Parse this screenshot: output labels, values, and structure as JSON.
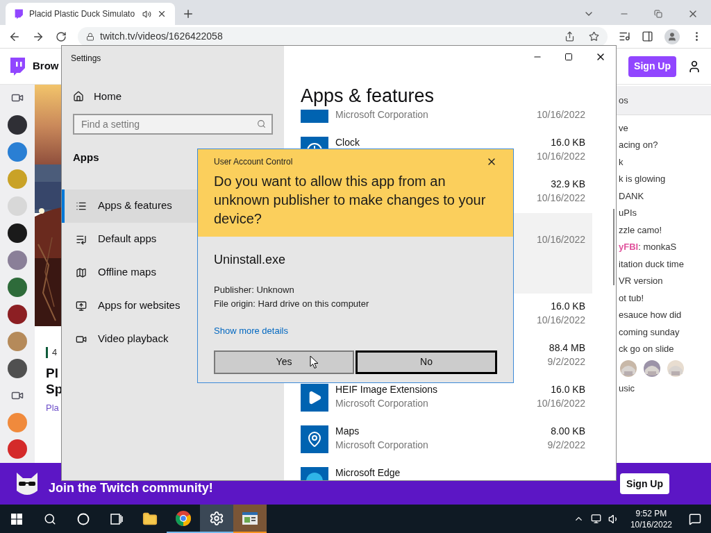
{
  "browser": {
    "tabs": [
      {
        "title": "Placid Plastic Duck Simulato",
        "selected": true,
        "audio": true
      }
    ],
    "url": "twitch.tv/videos/1626422058"
  },
  "twitch": {
    "nav_link": "Brow",
    "sign_up": "Sign Up",
    "rail": [
      {
        "kind": "camera"
      },
      {
        "kind": "avatar",
        "color": "#2f2f35"
      },
      {
        "kind": "avatar",
        "color": "#2a7fd4"
      },
      {
        "kind": "avatar",
        "color": "#c9a227"
      },
      {
        "kind": "avatar",
        "color": "#d8d8d8"
      },
      {
        "kind": "avatar",
        "color": "#1a1a1a"
      },
      {
        "kind": "avatar",
        "color": "#8a7f98"
      },
      {
        "kind": "avatar",
        "color": "#2e6b3a"
      },
      {
        "kind": "avatar",
        "color": "#8c1f23"
      },
      {
        "kind": "avatar",
        "color": "#b58a5a"
      },
      {
        "kind": "avatar",
        "color": "#505050"
      },
      {
        "kind": "camera"
      },
      {
        "kind": "avatar",
        "color": "#f08a3c"
      },
      {
        "kind": "avatar",
        "color": "#d42a2a"
      }
    ],
    "video": {
      "tag": "4",
      "title_lines": [
        "Pl",
        "Sp"
      ],
      "channel": "Pla"
    },
    "chat": {
      "header": "os",
      "messages": [
        {
          "kind": "text",
          "text": "ve"
        },
        {
          "kind": "text",
          "text": "acing on?"
        },
        {
          "kind": "text",
          "text": "k"
        },
        {
          "kind": "text",
          "text": "k is glowing"
        },
        {
          "kind": "text",
          "text": "DANK"
        },
        {
          "kind": "text",
          "text": "uPIs"
        },
        {
          "kind": "text",
          "text": "zzle camo!"
        },
        {
          "kind": "text",
          "user": "yFBI",
          "color": "#e0529c",
          "text": ": monkaS"
        },
        {
          "kind": "text",
          "text": "itation duck time"
        },
        {
          "kind": "text",
          "text": "VR version"
        },
        {
          "kind": "text",
          "text": "ot tub!"
        },
        {
          "kind": "text",
          "text": "esauce how did"
        },
        {
          "kind": "text",
          "text": "coming sunday"
        },
        {
          "kind": "text",
          "text": "ck go on slide"
        },
        {
          "kind": "emotes"
        },
        {
          "kind": "text",
          "text": "usic"
        }
      ]
    },
    "banner": {
      "text": "Join the Twitch community!",
      "button": "Sign Up"
    }
  },
  "settings": {
    "title": "Settings",
    "home": "Home",
    "search_placeholder": "Find a setting",
    "section": "Apps",
    "nav": [
      {
        "label": "Apps & features",
        "kind": "list",
        "selected": true
      },
      {
        "label": "Default apps",
        "kind": "defaults",
        "selected": false
      },
      {
        "label": "Offline maps",
        "kind": "map",
        "selected": false
      },
      {
        "label": "Apps for websites",
        "kind": "websites",
        "selected": false
      },
      {
        "label": "Video playback",
        "kind": "video",
        "selected": false
      }
    ],
    "heading": "Apps & features",
    "apps": [
      {
        "kind": "generic",
        "publisher": "Microsoft Corporation",
        "date": "10/16/2022",
        "selected": false
      },
      {
        "kind": "clock",
        "name": "Clock",
        "size": "16.0 KB",
        "date": "10/16/2022",
        "selected": false
      },
      {
        "size": "32.9 KB",
        "date": "10/16/2022",
        "selected": false
      },
      {
        "date": "10/16/2022",
        "selected": true
      },
      {
        "size": "16.0 KB",
        "date": "10/16/2022",
        "selected": false
      },
      {
        "size": "88.4 MB",
        "date": "9/2/2022",
        "selected": false
      },
      {
        "kind": "heif",
        "name": "HEIF Image Extensions",
        "publisher": "Microsoft Corporation",
        "size": "16.0 KB",
        "date": "10/16/2022",
        "selected": false
      },
      {
        "kind": "maps",
        "name": "Maps",
        "publisher": "Microsoft Corporation",
        "size": "8.00 KB",
        "date": "9/2/2022",
        "selected": false
      },
      {
        "kind": "edge",
        "name": "Microsoft Edge",
        "selected": false
      }
    ]
  },
  "uac": {
    "title": "User Account Control",
    "question": "Do you want to allow this app from an unknown publisher to make changes to your device?",
    "program": "Uninstall.exe",
    "details": [
      "Publisher: Unknown",
      "File origin: Hard drive on this computer"
    ],
    "link": "Show more details",
    "buttons": [
      {
        "label": "Yes",
        "focused": false
      },
      {
        "label": "No",
        "focused": true
      }
    ]
  },
  "taskbar": {
    "apps": [
      {
        "kind": "start"
      },
      {
        "kind": "search"
      },
      {
        "kind": "cortana"
      },
      {
        "kind": "taskview"
      },
      {
        "kind": "explorer",
        "running": false,
        "selected": false,
        "flashing": false
      },
      {
        "kind": "chrome",
        "running": true,
        "selected": false,
        "flashing": false
      },
      {
        "kind": "settings",
        "running": true,
        "selected": true,
        "flashing": false
      },
      {
        "kind": "uac",
        "running": true,
        "selected": false,
        "flashing": true
      }
    ],
    "time": "9:52 PM",
    "date": "10/16/2022"
  }
}
